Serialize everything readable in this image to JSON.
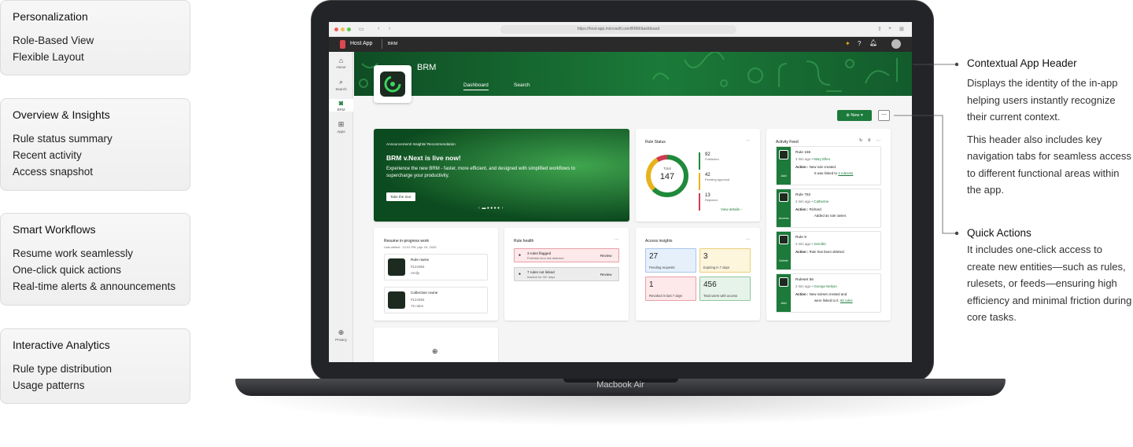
{
  "features": [
    {
      "title": "Personalization",
      "items": [
        "Role-Based View",
        "Flexible Layout"
      ]
    },
    {
      "title": "Overview & Insights",
      "items": [
        "Rule status summary",
        "Recent activity",
        "Access snapshot"
      ]
    },
    {
      "title": "Smart Workflows",
      "items": [
        "Resume work seamlessly",
        "One-click quick actions",
        "Real-time alerts & announcements"
      ]
    },
    {
      "title": "Interactive Analytics",
      "items": [
        "Rule type distribution",
        "Usage patterns"
      ]
    }
  ],
  "callouts": {
    "header_title": "Contextual App Header",
    "header_p1": "Displays the identity of the in-app helping users instantly recognize their current context.",
    "header_p2": "This header also includes key navigation tabs for seamless access to different functional areas within the app.",
    "qa_title": "Quick Actions",
    "qa_p1": "It includes one-click access to create new entities—such as rules, rulesets, or feeds—ensuring high efficiency and minimal friction during core tasks."
  },
  "device_label": "Macbook Air",
  "browser": {
    "url": "https://host-app.microsoft.com/BRM/dashboard"
  },
  "app": {
    "host_name": "Host App",
    "app_short": "BRM",
    "title": "BRM",
    "tabs": [
      "Dashboard",
      "Search"
    ],
    "rail": [
      "Home",
      "Search",
      "BRM",
      "Apps",
      "Privacy"
    ],
    "new_label": "New",
    "more_label": "⋯"
  },
  "banner": {
    "eyebrow": "Announcement/ Insights/ Recommendation",
    "title": "BRM v.Next is live now!",
    "body": "Experience the new BRM - faster, more efficient, and designed with simplified workflows to supercharge your productivity.",
    "cta": "Take the tour"
  },
  "rule_status": {
    "title": "Rule Status",
    "total_label": "Total",
    "total": "147",
    "items": [
      {
        "value": "92",
        "label": "Published",
        "color": "#1f8a3a"
      },
      {
        "value": "42",
        "label": "Pending approval",
        "color": "#e7b21b"
      },
      {
        "value": "13",
        "label": "Rejected",
        "color": "#d13a52"
      }
    ],
    "view_details": "View details"
  },
  "activity": {
    "title": "Activity Feed",
    "items": [
      {
        "name": "Rule 155",
        "time": "2 min ago",
        "user": "Mary Ellen",
        "action_label": "Action :",
        "line1": "New rule created.",
        "line2": "It was linked to",
        "link": "3 rulesets",
        "tag": "Add"
      },
      {
        "name": "Rule 752",
        "time": "2 min ago",
        "user": "Catherine",
        "action_label": "Action :",
        "line1": "Richard",
        "line2": "Added as rule owner.",
        "link": "",
        "tag": "Access"
      },
      {
        "name": "Rule 9",
        "time": "2 min ago",
        "user": "Jennifer",
        "action_label": "Action :",
        "line1": "Rule has been deleted.",
        "line2": "",
        "link": "",
        "tag": "Delete"
      },
      {
        "name": "Ruleset 56",
        "time": "2 min ago",
        "user": "George Nelson",
        "action_label": "Action :",
        "line1": "New ruleset created and",
        "line2": "were linked to it.",
        "link": "82 rules",
        "tag": "Add"
      }
    ]
  },
  "resume": {
    "title": "Resume in-progress work",
    "last_visited": "Last visited : 12:31 PM | Apr 24, 2025",
    "items": [
      {
        "name": "Rule name",
        "id": "#124364",
        "meta": "Amily"
      },
      {
        "name": "Collection name",
        "id": "#124364",
        "meta": "72 rules"
      }
    ]
  },
  "rule_health": {
    "title": "Rule health",
    "items": [
      {
        "title": "3 rules flagged",
        "sub": "Potential error risk detected",
        "action": "Review"
      },
      {
        "title": "7 rules not linked",
        "sub": "Inactive for 30+ days",
        "action": "Review"
      }
    ]
  },
  "access": {
    "title": "Access insights",
    "tiles": [
      {
        "value": "27",
        "label": "Pending requests",
        "bg": "#e6f0fb",
        "border": "#a9c7ea"
      },
      {
        "value": "3",
        "label": "Expiring in 7 days",
        "bg": "#fdf5dc",
        "border": "#e9cf7b"
      },
      {
        "value": "1",
        "label": "Revoked in last 7 days",
        "bg": "#fde8ea",
        "border": "#e8a0a8"
      },
      {
        "value": "456",
        "label": "Total users with access",
        "bg": "#e6f3ea",
        "border": "#8fc79d"
      }
    ]
  },
  "colors": {
    "accent": "#1c7a3a",
    "dark": "#2a2a2a"
  }
}
